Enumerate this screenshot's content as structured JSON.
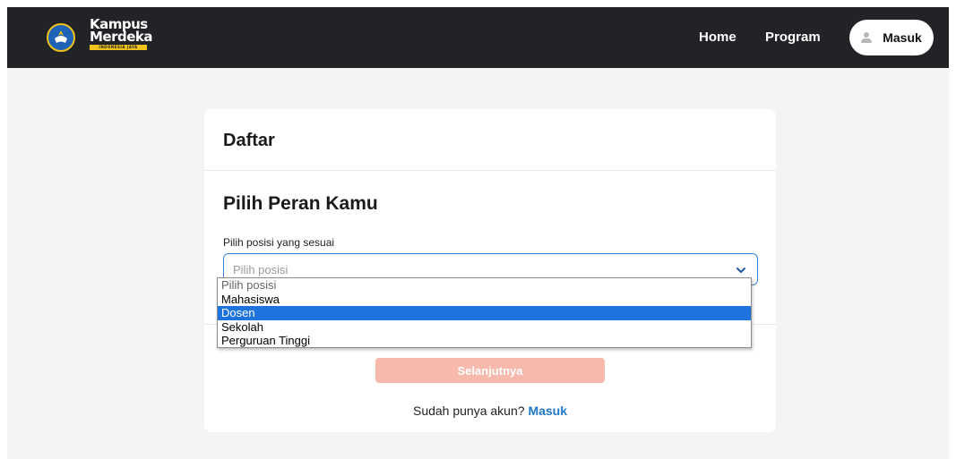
{
  "navbar": {
    "logo_text_line1": "Kampus",
    "logo_text_line2": "Merdeka",
    "logo_tagline": "INDONESIA JAYA",
    "links": [
      "Home",
      "Program"
    ],
    "login_label": "Masuk",
    "background_color": "#222326"
  },
  "card": {
    "title": "Daftar",
    "section_title": "Pilih Peran Kamu",
    "field_label": "Pilih posisi yang sesuai",
    "select_value": "Pilih posisi",
    "options": [
      "Pilih posisi",
      "Mahasiswa",
      "Dosen",
      "Sekolah",
      "Perguruan Tinggi"
    ],
    "highlighted_option": "Dosen",
    "next_button": "Selanjutnya",
    "footer_prompt": "Sudah punya akun?",
    "footer_link": "Masuk"
  },
  "colors": {
    "accent_blue": "#1e73dc",
    "link_blue": "#1e78c8",
    "button_disabled": "#f7b9ab"
  }
}
